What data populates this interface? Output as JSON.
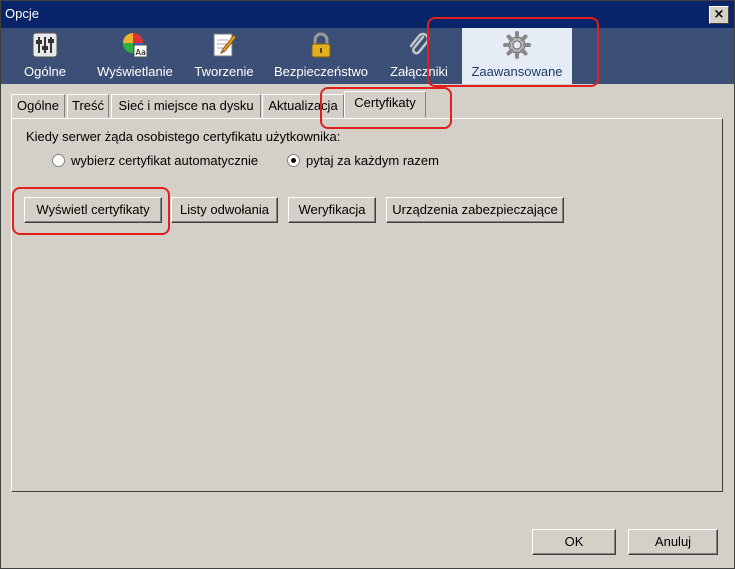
{
  "window": {
    "title": "Opcje",
    "close_label": "×"
  },
  "toolbar": {
    "items": [
      {
        "label": "Ogólne",
        "icon": "sliders-icon"
      },
      {
        "label": "Wyświetlanie",
        "icon": "color-wheel-icon"
      },
      {
        "label": "Tworzenie",
        "icon": "pencil-note-icon"
      },
      {
        "label": "Bezpieczeństwo",
        "icon": "padlock-icon"
      },
      {
        "label": "Załączniki",
        "icon": "paperclip-icon"
      },
      {
        "label": "Zaawansowane",
        "icon": "gear-icon",
        "selected": true
      }
    ]
  },
  "tabs": [
    {
      "label": "Ogólne"
    },
    {
      "label": "Treść"
    },
    {
      "label": "Sieć i miejsce na dysku"
    },
    {
      "label": "Aktualizacja"
    },
    {
      "label": "Certyfikaty",
      "active": true
    }
  ],
  "certificates": {
    "prompt": "Kiedy serwer żąda osobistego certyfikatu użytkownika:",
    "option_auto": "wybierz certyfikat automatycznie",
    "option_ask": "pytaj za każdym razem",
    "selected_option": "pytaj za każdym razem",
    "buttons": {
      "view": "Wyświetl certyfikaty",
      "revocation": "Listy odwołania",
      "verification": "Weryfikacja",
      "devices": "Urządzenia zabezpieczające"
    }
  },
  "footer": {
    "ok": "OK",
    "cancel": "Anuluj"
  },
  "colors": {
    "titlebar": "#0a246a",
    "toolbar": "#3c4f76",
    "highlight": "#e0201e"
  }
}
